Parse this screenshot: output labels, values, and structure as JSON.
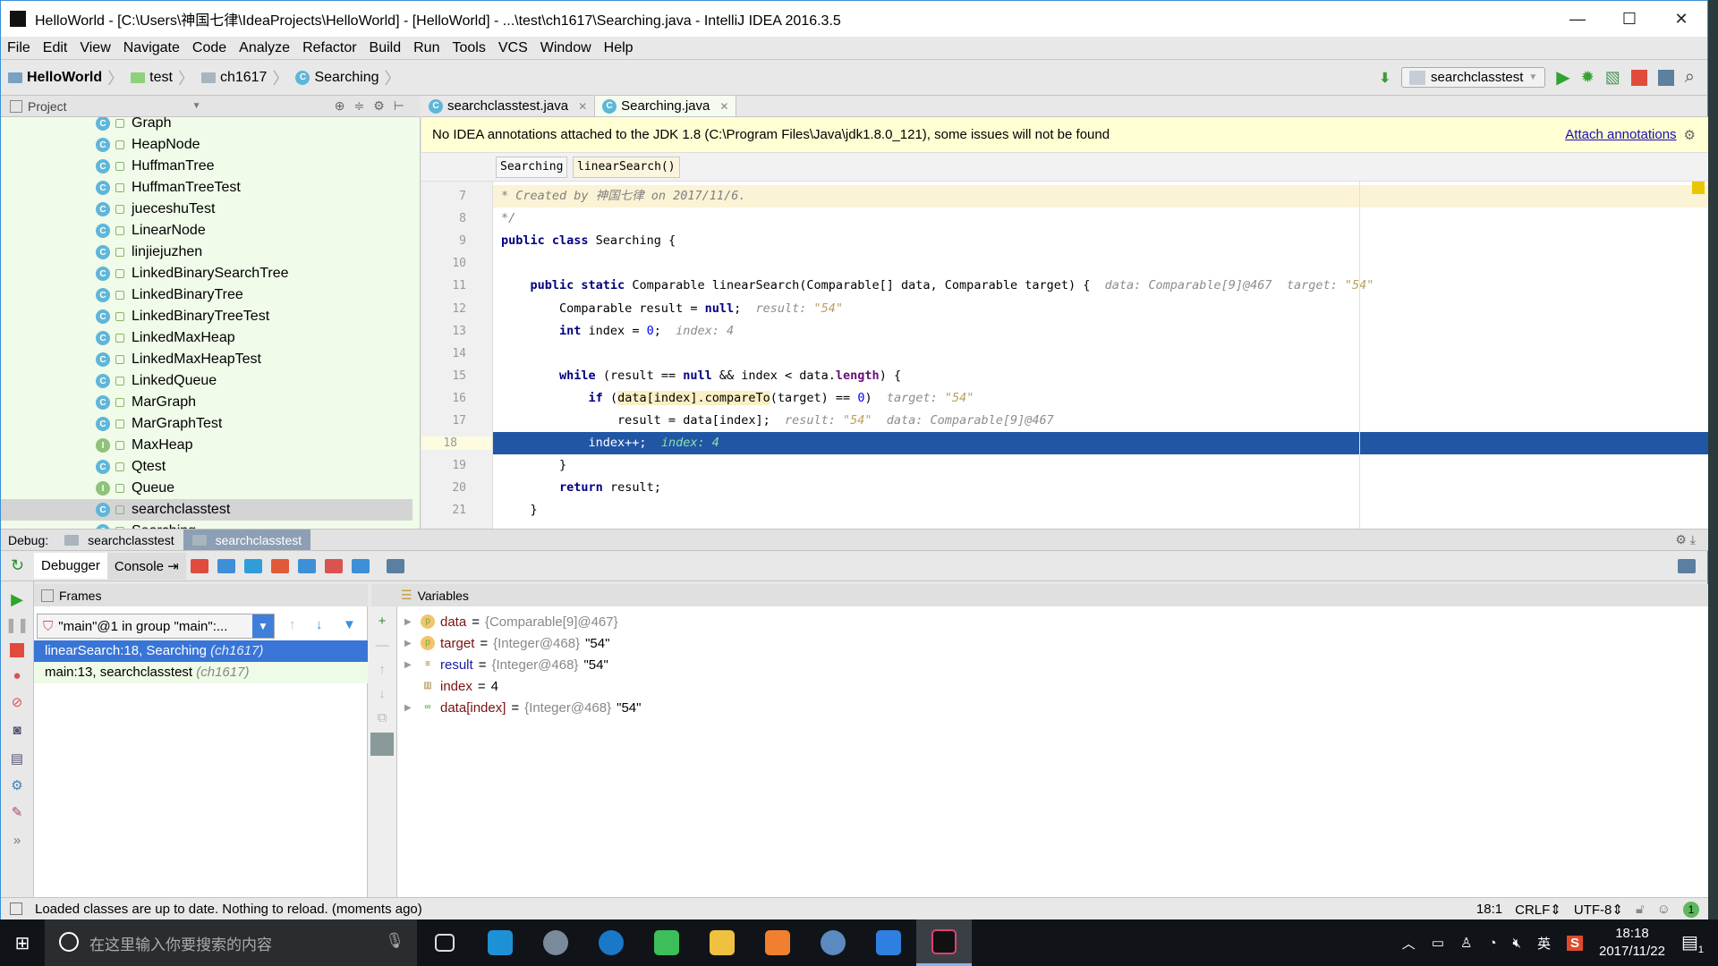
{
  "window": {
    "title": "HelloWorld - [C:\\Users\\神国七律\\IdeaProjects\\HelloWorld] - [HelloWorld] - ...\\test\\ch1617\\Searching.java - IntelliJ IDEA 2016.3.5",
    "controls": [
      "—",
      "☐",
      "✕"
    ]
  },
  "menu": [
    "File",
    "Edit",
    "View",
    "Navigate",
    "Code",
    "Analyze",
    "Refactor",
    "Build",
    "Run",
    "Tools",
    "VCS",
    "Window",
    "Help"
  ],
  "breadcrumb": [
    "HelloWorld",
    "test",
    "ch1617",
    "Searching"
  ],
  "run_config": "searchclasstest",
  "project": {
    "label": "Project",
    "items": [
      {
        "name": "Graph",
        "icon": "class"
      },
      {
        "name": "HeapNode",
        "icon": "class"
      },
      {
        "name": "HuffmanTree",
        "icon": "class"
      },
      {
        "name": "HuffmanTreeTest",
        "icon": "class-runnable"
      },
      {
        "name": "jueceshuTest",
        "icon": "class-runnable"
      },
      {
        "name": "LinearNode",
        "icon": "class"
      },
      {
        "name": "linjiejuzhen",
        "icon": "class-runnable"
      },
      {
        "name": "LinkedBinarySearchTree",
        "icon": "class"
      },
      {
        "name": "LinkedBinaryTree",
        "icon": "class"
      },
      {
        "name": "LinkedBinaryTreeTest",
        "icon": "class-runnable"
      },
      {
        "name": "LinkedMaxHeap",
        "icon": "class"
      },
      {
        "name": "LinkedMaxHeapTest",
        "icon": "class-runnable"
      },
      {
        "name": "LinkedQueue",
        "icon": "class"
      },
      {
        "name": "MarGraph",
        "icon": "class"
      },
      {
        "name": "MarGraphTest",
        "icon": "class-runnable"
      },
      {
        "name": "MaxHeap",
        "icon": "interface"
      },
      {
        "name": "Qtest",
        "icon": "class-runnable"
      },
      {
        "name": "Queue",
        "icon": "interface"
      },
      {
        "name": "searchclasstest",
        "icon": "class-runnable",
        "selected": true
      },
      {
        "name": "Searching",
        "icon": "class"
      }
    ]
  },
  "editor": {
    "tabs": [
      {
        "label": "searchclasstest.java",
        "active": false
      },
      {
        "label": "Searching.java",
        "active": true
      }
    ],
    "notice": "No IDEA annotations attached to the JDK 1.8 (C:\\Program Files\\Java\\jdk1.8.0_121), some issues will not be found",
    "notice_link": "Attach annotations",
    "crumbs": [
      "Searching",
      "linearSearch()"
    ],
    "current_line": 18,
    "lines": [
      {
        "n": 7,
        "t": [
          [
            "cm",
            "* Created by 神国七律 on 2017/11/6."
          ]
        ],
        "bg": "doc"
      },
      {
        "n": 8,
        "t": [
          [
            "cm",
            "*/"
          ]
        ]
      },
      {
        "n": 9,
        "t": [
          [
            "kw",
            "public class "
          ],
          [
            "",
            "Searching {"
          ]
        ]
      },
      {
        "n": 10,
        "t": []
      },
      {
        "n": 11,
        "t": [
          [
            "",
            "    "
          ],
          [
            "kw",
            "public static "
          ],
          [
            "",
            "Comparable linearSearch(Comparable[] data, Comparable target) {  "
          ],
          [
            "hn",
            "data: Comparable[9]@467  target: "
          ],
          [
            "hs",
            "\"54\""
          ]
        ]
      },
      {
        "n": 12,
        "t": [
          [
            "",
            "        Comparable result = "
          ],
          [
            "kw",
            "null"
          ],
          [
            "",
            ";  "
          ],
          [
            "hn",
            "result: "
          ],
          [
            "hs",
            "\"54\""
          ]
        ]
      },
      {
        "n": 13,
        "t": [
          [
            "",
            "        "
          ],
          [
            "kw",
            "int "
          ],
          [
            "",
            "index = "
          ],
          [
            "nm",
            "0"
          ],
          [
            "",
            ";  "
          ],
          [
            "hn",
            "index: 4"
          ]
        ]
      },
      {
        "n": 14,
        "t": []
      },
      {
        "n": 15,
        "t": [
          [
            "",
            "        "
          ],
          [
            "kw",
            "while "
          ],
          [
            "",
            "(result == "
          ],
          [
            "kw",
            "null "
          ],
          [
            "",
            "&& index < data."
          ],
          [
            "mt",
            "length"
          ],
          [
            "",
            ") {"
          ]
        ]
      },
      {
        "n": 16,
        "t": [
          [
            "",
            "            "
          ],
          [
            "kw",
            "if "
          ],
          [
            "",
            "("
          ],
          [
            "hl",
            "data[index].compareTo"
          ],
          [
            "",
            "(target) == "
          ],
          [
            "nm",
            "0"
          ],
          [
            "",
            ")  "
          ],
          [
            "hn",
            "target: "
          ],
          [
            "hs",
            "\"54\""
          ]
        ]
      },
      {
        "n": 17,
        "t": [
          [
            "",
            "                result = data[index];  "
          ],
          [
            "hn",
            "result: "
          ],
          [
            "hs",
            "\"54\""
          ],
          [
            "hn",
            "  data: Comparable[9]@467"
          ]
        ]
      },
      {
        "n": 18,
        "t": [
          [
            "",
            "            index++;  "
          ],
          [
            "hn",
            "index: 4"
          ]
        ]
      },
      {
        "n": 19,
        "t": [
          [
            "",
            "        }"
          ]
        ]
      },
      {
        "n": 20,
        "t": [
          [
            "",
            "        "
          ],
          [
            "kw",
            "return "
          ],
          [
            "",
            "result;"
          ]
        ]
      },
      {
        "n": 21,
        "t": [
          [
            "",
            "    }"
          ]
        ]
      }
    ]
  },
  "debug": {
    "label": "Debug:",
    "sessions": [
      {
        "label": "searchclasstest",
        "active": false
      },
      {
        "label": "searchclasstest",
        "active": true
      }
    ],
    "tabs": [
      "Debugger",
      "Console"
    ],
    "frames_label": "Frames",
    "thread": "\"main\"@1 in group \"main\":...",
    "frames": [
      {
        "text": "linearSearch:18, Searching",
        "pkg": "(ch1617)",
        "selected": true
      },
      {
        "text": "main:13, searchclasstest",
        "pkg": "(ch1617)"
      }
    ],
    "variables_label": "Variables",
    "variables": [
      {
        "name": "data",
        "type": "{Comparable[9]@467}",
        "value": "",
        "icon": "parameter",
        "expandable": true
      },
      {
        "name": "target",
        "type": "{Integer@468}",
        "value": "\"54\"",
        "icon": "parameter",
        "expandable": true
      },
      {
        "name": "result",
        "type": "{Integer@468}",
        "value": "\"54\"",
        "icon": "local",
        "expandable": true
      },
      {
        "name": "index",
        "type": "",
        "value": "4",
        "icon": "primitive",
        "expandable": false
      },
      {
        "name": "data[index]",
        "type": "{Integer@468}",
        "value": "\"54\"",
        "icon": "watch",
        "expandable": true
      }
    ]
  },
  "status": {
    "message": "Loaded classes are up to date. Nothing to reload. (moments ago)",
    "position": "18:1",
    "line_sep": "CRLF",
    "encoding": "UTF-8",
    "notifications": "1"
  },
  "taskbar": {
    "search_placeholder": "在这里输入你要搜索的内容",
    "ime": "英",
    "time": "18:18",
    "date": "2017/11/22",
    "action_center_count": "1"
  }
}
